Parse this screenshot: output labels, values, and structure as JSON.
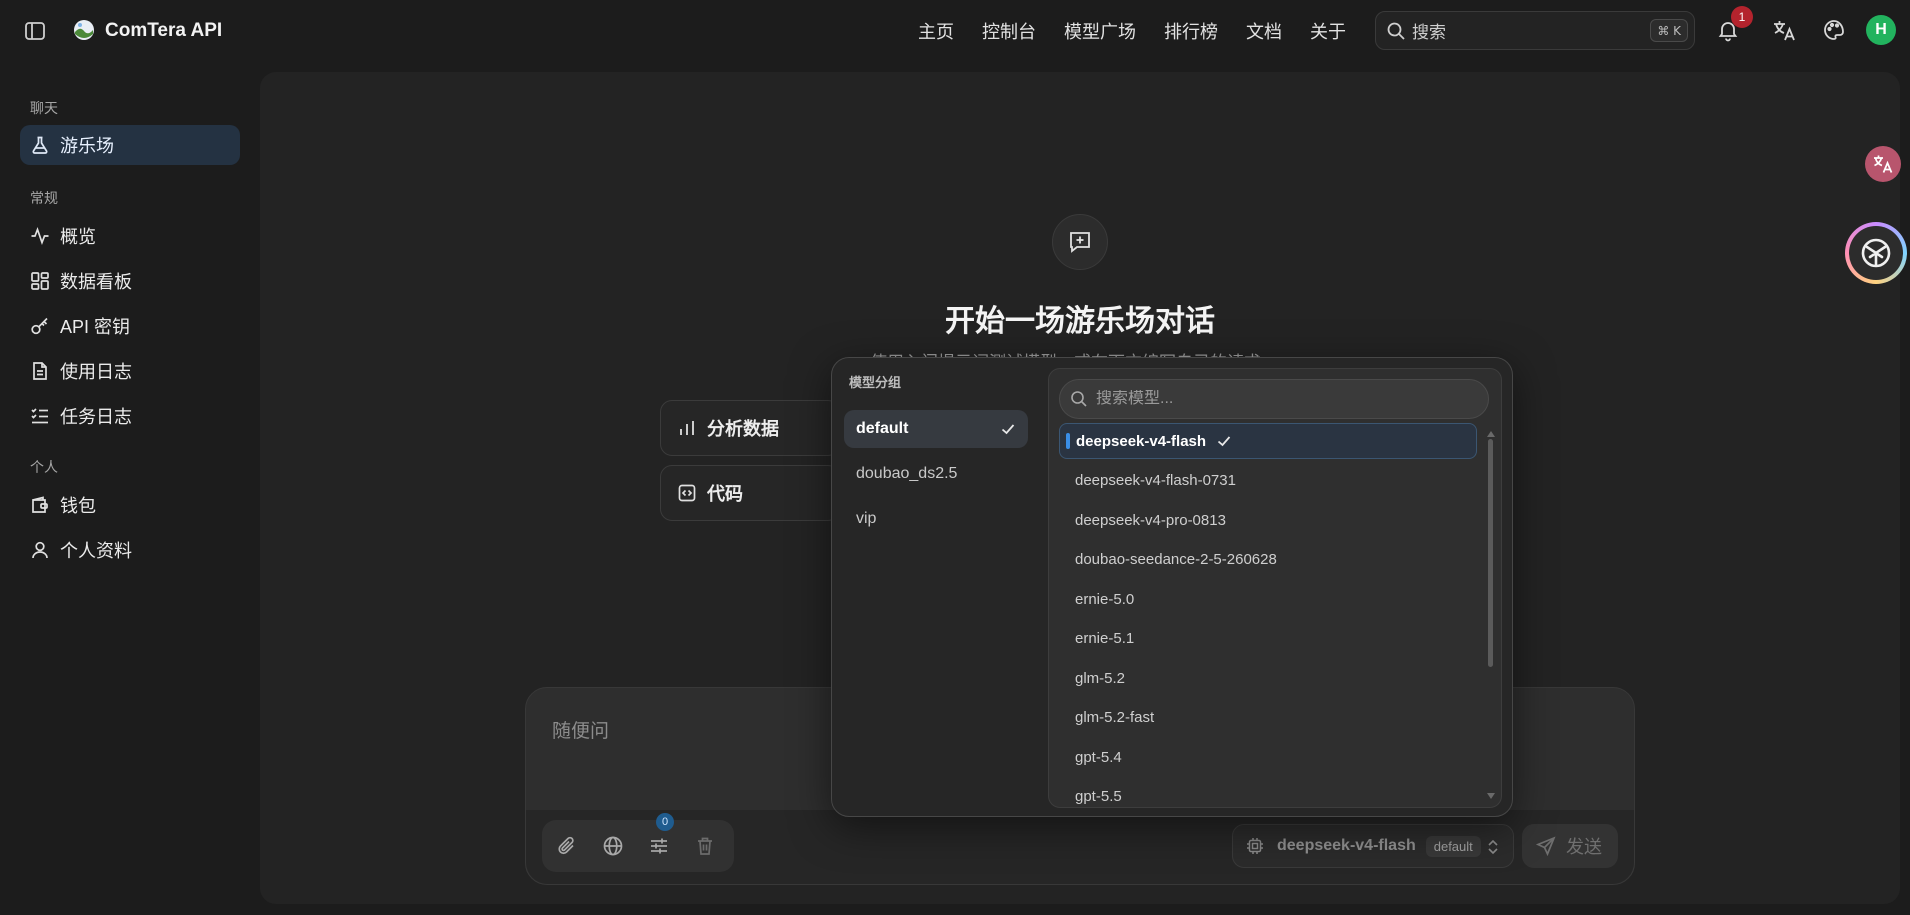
{
  "header": {
    "brand": "ComTera API",
    "nav": [
      "主页",
      "控制台",
      "模型广场",
      "排行榜",
      "文档",
      "关于"
    ],
    "search_placeholder": "搜索",
    "search_shortcut": "⌘ K",
    "notification_count": "1",
    "avatar_initial": "H"
  },
  "sidebar": {
    "sections": [
      {
        "label": "聊天",
        "items": [
          {
            "label": "游乐场",
            "icon": "flask-icon",
            "active": true
          }
        ]
      },
      {
        "label": "常规",
        "items": [
          {
            "label": "概览",
            "icon": "activity-icon"
          },
          {
            "label": "数据看板",
            "icon": "dashboard-icon"
          },
          {
            "label": "API 密钥",
            "icon": "key-icon"
          },
          {
            "label": "使用日志",
            "icon": "file-text-icon"
          },
          {
            "label": "任务日志",
            "icon": "list-check-icon"
          }
        ]
      },
      {
        "label": "个人",
        "items": [
          {
            "label": "钱包",
            "icon": "wallet-icon"
          },
          {
            "label": "个人资料",
            "icon": "user-icon"
          }
        ]
      }
    ]
  },
  "main": {
    "title": "开始一场游乐场对话",
    "subtitle": "使用入门提示词测试模型，或在下方编写自己的请求",
    "prompt_cards": [
      "分析数据",
      "代码"
    ]
  },
  "composer": {
    "placeholder": "随便问",
    "settings_badge": "0",
    "model_name": "deepseek-v4-flash",
    "model_group": "default",
    "send_label": "发送"
  },
  "popup": {
    "groups_title": "模型分组",
    "groups": [
      {
        "label": "default",
        "selected": true
      },
      {
        "label": "doubao_ds2.5",
        "selected": false
      },
      {
        "label": "vip",
        "selected": false
      }
    ],
    "search_placeholder": "搜索模型...",
    "models": [
      {
        "label": "deepseek-v4-flash",
        "selected": true
      },
      {
        "label": "deepseek-v4-flash-0731",
        "selected": false
      },
      {
        "label": "deepseek-v4-pro-0813",
        "selected": false
      },
      {
        "label": "doubao-seedance-2-5-260628",
        "selected": false
      },
      {
        "label": "ernie-5.0",
        "selected": false
      },
      {
        "label": "ernie-5.1",
        "selected": false
      },
      {
        "label": "glm-5.2",
        "selected": false
      },
      {
        "label": "glm-5.2-fast",
        "selected": false
      },
      {
        "label": "gpt-5.4",
        "selected": false
      },
      {
        "label": "gpt-5.5",
        "selected": false
      }
    ]
  },
  "colors": {
    "accent": "#3a8ee6",
    "active_bg": "#243242",
    "avatar": "#22b35e",
    "badge": "#b4232d"
  }
}
